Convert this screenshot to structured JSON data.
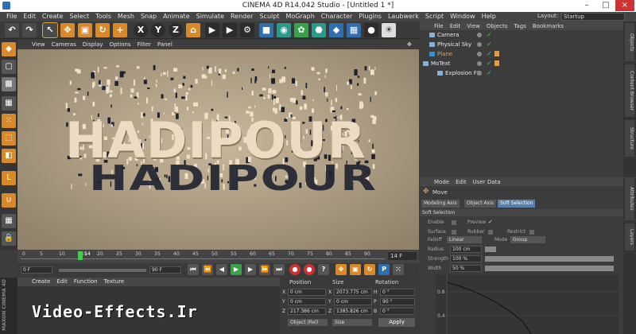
{
  "window": {
    "title": "CINEMA 4D R14.042 Studio - [Untitled 1 *]"
  },
  "menubar": {
    "items": [
      "File",
      "Edit",
      "Create",
      "Select",
      "Tools",
      "Mesh",
      "Snap",
      "Animate",
      "Simulate",
      "Render",
      "Sculpt",
      "MoGraph",
      "Character",
      "Plugins",
      "Laubwerk",
      "Script",
      "Window",
      "Help"
    ],
    "layout_label": "Layout:",
    "layout_value": "Startup"
  },
  "viewport": {
    "menu": [
      "View",
      "Cameras",
      "Display",
      "Options",
      "Filter",
      "Panel"
    ],
    "text_main": "HADIPOUR",
    "text_shadow": "HADIPOUR"
  },
  "timeline": {
    "ticks": [
      "0",
      "5",
      "10",
      "14",
      "15",
      "20",
      "25",
      "30",
      "35",
      "40",
      "45",
      "50",
      "55",
      "60",
      "65",
      "70",
      "75",
      "80",
      "85",
      "90"
    ],
    "frame_end_label": "14 F"
  },
  "transport": {
    "start": "0 F",
    "end": "90 F"
  },
  "materials": {
    "menu": [
      "Create",
      "Edit",
      "Function",
      "Texture"
    ]
  },
  "coords": {
    "headers": [
      "Position",
      "Size",
      "Rotation"
    ],
    "rows": [
      {
        "axis": "X",
        "pos": "0 cm",
        "size_axis": "X",
        "size": "2073.775 cm",
        "rot_axis": "H",
        "rot": "0 °"
      },
      {
        "axis": "Y",
        "pos": "0 cm",
        "size_axis": "Y",
        "size": "0 cm",
        "rot_axis": "P",
        "rot": "90 °"
      },
      {
        "axis": "Z",
        "pos": "217.386 cm",
        "size_axis": "Z",
        "size": "1385.826 cm",
        "rot_axis": "B",
        "rot": "0 °"
      }
    ],
    "mode_select": "Object (Rel)",
    "size_select": "Size",
    "apply": "Apply"
  },
  "objmgr": {
    "menu": [
      "File",
      "Edit",
      "View",
      "Objects",
      "Tags",
      "Bookmarks"
    ],
    "objects": [
      {
        "name": "Camera",
        "color": "#e8e8e8"
      },
      {
        "name": "Physical Sky",
        "color": "#e8e8e8"
      },
      {
        "name": "Plane",
        "color": "#f0a040"
      },
      {
        "name": "MoText",
        "color": "#e8e8e8"
      },
      {
        "name": "Explosion FX",
        "color": "#e8e8e8"
      }
    ]
  },
  "attrmgr": {
    "menu": [
      "Mode",
      "Edit",
      "User Data"
    ],
    "title": "Move",
    "tabs": [
      "Modeling Axis",
      "Object Axis",
      "Soft Selection"
    ],
    "section": "Soft Selection",
    "fields": {
      "enable": "Enable",
      "preview": "Preview",
      "surface": "Surface",
      "rubber": "Rubber",
      "restrict": "Restrict",
      "falloff": "Falloff",
      "falloff_value": "Linear",
      "mode": "Mode",
      "mode_value": "Group",
      "radius": "Radius",
      "radius_value": "100 cm",
      "strength": "Strength",
      "strength_value": "100 %",
      "width": "Width",
      "width_value": "50 %"
    },
    "graph_labels": [
      "0.8",
      "0.4"
    ]
  },
  "rightstrip": [
    "Objects",
    "Content Browser",
    "Structure",
    "Attributes",
    "Layers"
  ],
  "branding": {
    "maxon": "MAXON CINEMA 4D",
    "watermark": "Video-Effects.Ir"
  }
}
